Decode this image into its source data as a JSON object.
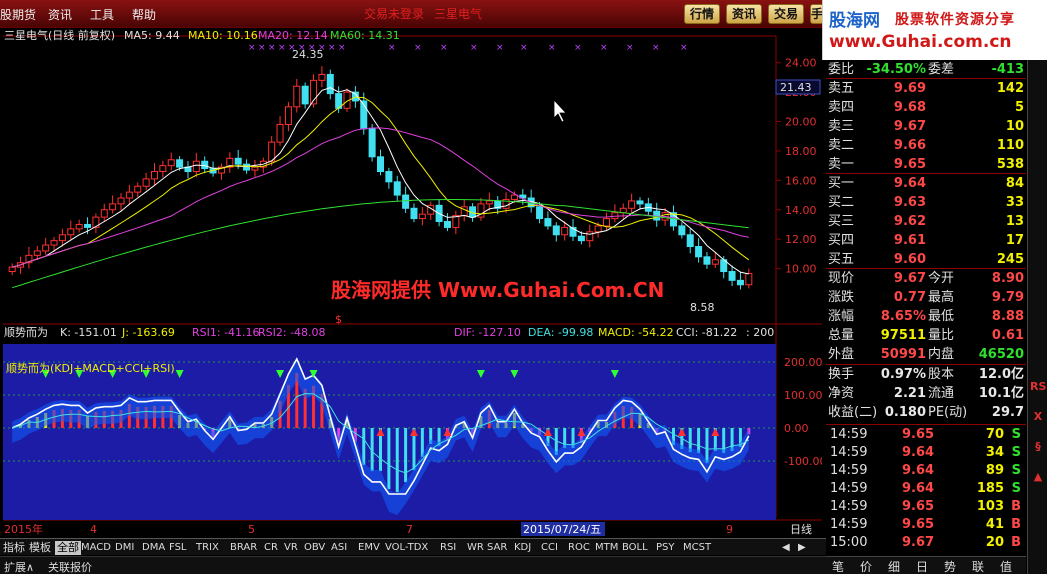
{
  "menu": {
    "items": [
      "股期货",
      "资讯",
      "工具",
      "帮助"
    ],
    "title": "交易未登录",
    "title_alt": "三星电气",
    "buttons": [
      "行情",
      "资讯",
      "交易",
      "手"
    ]
  },
  "logo": {
    "brand": "股海网",
    "tagline": "股票软件资源分享",
    "url": "www.Guhai.com.cn"
  },
  "watermark": "股海网提供 Www.Guhai.Com.CN",
  "main_chart": {
    "header": {
      "stock": "三星电气(日线 前复权)",
      "ma5": "MA5: 9.44",
      "ma10": "MA10: 10.16",
      "ma20": "MA20: 12.14",
      "ma60": "MA60: 14.31"
    },
    "price_axis": [
      "24.00",
      "22.00",
      "20.00",
      "18.00",
      "16.00",
      "14.00",
      "12.00",
      "10.00"
    ],
    "current_price_tag": "21.43",
    "high_label": "24.35",
    "low_label": "8.58",
    "dollar_mark": "$"
  },
  "indicator": {
    "title": "顺势而为",
    "k": "K: -151.01",
    "j": "J: -163.69",
    "rsi1": "RSI1: -41.16",
    "rsi2": "RSI2: -48.08",
    "dif": "DIF: -127.10",
    "dea": "DEA: -99.98",
    "macd": "MACD: -54.22",
    "cci": "CCI: -81.22",
    "extra": ": 200",
    "inner_label": "顺势而为(KDJ+MACD+CCI+RSI)",
    "axis": [
      "200.00",
      "100.00",
      "0.00",
      "-100.00"
    ]
  },
  "date_axis": {
    "labels": [
      "2015年",
      "4",
      "5",
      "7",
      "9"
    ],
    "highlight": "2015/07/24/五",
    "period": "日线"
  },
  "tabs": {
    "items": [
      "指标",
      "模板",
      "全部",
      "MACD",
      "DMI",
      "DMA",
      "FSL",
      "TRIX",
      "BRAR",
      "CR",
      "VR",
      "OBV",
      "ASI",
      "EMV",
      "VOL-TDX",
      "RSI",
      "WR",
      "SAR",
      "KDJ",
      "CCI",
      "ROC",
      "MTM",
      "BOLL",
      "PSY",
      "MCST"
    ],
    "active": "全部"
  },
  "sub_tabs": [
    "扩展∧",
    "关联报价"
  ],
  "quote": {
    "weibi": {
      "label": "委比",
      "value": "-34.50%",
      "label2": "委差",
      "value2": "-413"
    },
    "sells": [
      {
        "label": "卖五",
        "price": "9.69",
        "vol": "142"
      },
      {
        "label": "卖四",
        "price": "9.68",
        "vol": "5"
      },
      {
        "label": "卖三",
        "price": "9.67",
        "vol": "10"
      },
      {
        "label": "卖二",
        "price": "9.66",
        "vol": "110"
      },
      {
        "label": "卖一",
        "price": "9.65",
        "vol": "538"
      }
    ],
    "buys": [
      {
        "label": "买一",
        "price": "9.64",
        "vol": "84"
      },
      {
        "label": "买二",
        "price": "9.63",
        "vol": "33"
      },
      {
        "label": "买三",
        "price": "9.62",
        "vol": "13"
      },
      {
        "label": "买四",
        "price": "9.61",
        "vol": "17"
      },
      {
        "label": "买五",
        "price": "9.60",
        "vol": "245"
      }
    ],
    "stats": [
      {
        "l1": "现价",
        "v1": "9.67",
        "l2": "今开",
        "v2": "8.90"
      },
      {
        "l1": "涨跌",
        "v1": "0.77",
        "l2": "最高",
        "v2": "9.79"
      },
      {
        "l1": "涨幅",
        "v1": "8.65%",
        "l2": "最低",
        "v2": "8.88"
      },
      {
        "l1": "总量",
        "v1": "97511",
        "l2": "量比",
        "v2": "0.61"
      },
      {
        "l1": "外盘",
        "v1": "50991",
        "l2": "内盘",
        "v2": "46520"
      }
    ],
    "stats2": [
      {
        "l1": "换手",
        "v1": "0.97%",
        "l2": "股本",
        "v2": "12.0亿"
      },
      {
        "l1": "净资",
        "v1": "2.21",
        "l2": "流通",
        "v2": "10.1亿"
      },
      {
        "l1": "收益(二)",
        "v1": "0.180",
        "l2": "PE(动)",
        "v2": "29.7"
      }
    ],
    "ticks": [
      {
        "t": "14:59",
        "p": "9.65",
        "v": "70",
        "f": "S"
      },
      {
        "t": "14:59",
        "p": "9.64",
        "v": "34",
        "f": "S"
      },
      {
        "t": "14:59",
        "p": "9.64",
        "v": "89",
        "f": "S"
      },
      {
        "t": "14:59",
        "p": "9.64",
        "v": "185",
        "f": "S"
      },
      {
        "t": "14:59",
        "p": "9.65",
        "v": "103",
        "f": "B"
      },
      {
        "t": "14:59",
        "p": "9.65",
        "v": "41",
        "f": "B"
      },
      {
        "t": "15:00",
        "p": "9.67",
        "v": "20",
        "f": "B"
      }
    ]
  },
  "bottom_tabs": [
    "笔",
    "价",
    "细",
    "日",
    "势",
    "联",
    "值"
  ],
  "side_bar": [
    "RSI",
    "X",
    "§",
    "▲"
  ],
  "chart_data": {
    "type": "candlestick",
    "close": [
      10.1,
      10.4,
      10.9,
      11.2,
      11.6,
      11.9,
      12.3,
      12.7,
      13.0,
      12.8,
      13.5,
      14.0,
      14.4,
      14.8,
      15.2,
      15.6,
      16.1,
      16.6,
      17.0,
      17.4,
      16.9,
      16.6,
      17.3,
      16.8,
      16.5,
      16.9,
      17.5,
      17.1,
      16.7,
      16.9,
      17.3,
      18.6,
      19.8,
      21.0,
      22.4,
      21.2,
      22.8,
      23.2,
      21.9,
      20.9,
      22.0,
      21.4,
      19.5,
      17.6,
      16.6,
      15.9,
      15.0,
      14.1,
      13.4,
      13.7,
      14.3,
      13.2,
      12.8,
      13.6,
      14.2,
      13.5,
      14.4,
      14.6,
      14.1,
      14.7,
      15.0,
      14.8,
      14.2,
      13.4,
      12.9,
      12.3,
      12.8,
      12.2,
      11.9,
      12.5,
      12.9,
      13.4,
      13.8,
      14.1,
      14.6,
      14.4,
      13.9,
      13.3,
      13.8,
      12.9,
      12.3,
      11.5,
      10.8,
      10.3,
      10.6,
      9.8,
      9.2,
      8.9,
      9.67
    ],
    "ma20_end": 12.14,
    "ma60_end": 14.31,
    "ma5_end": 9.44,
    "ma10_end": 10.16,
    "ylim": [
      8,
      25
    ]
  }
}
